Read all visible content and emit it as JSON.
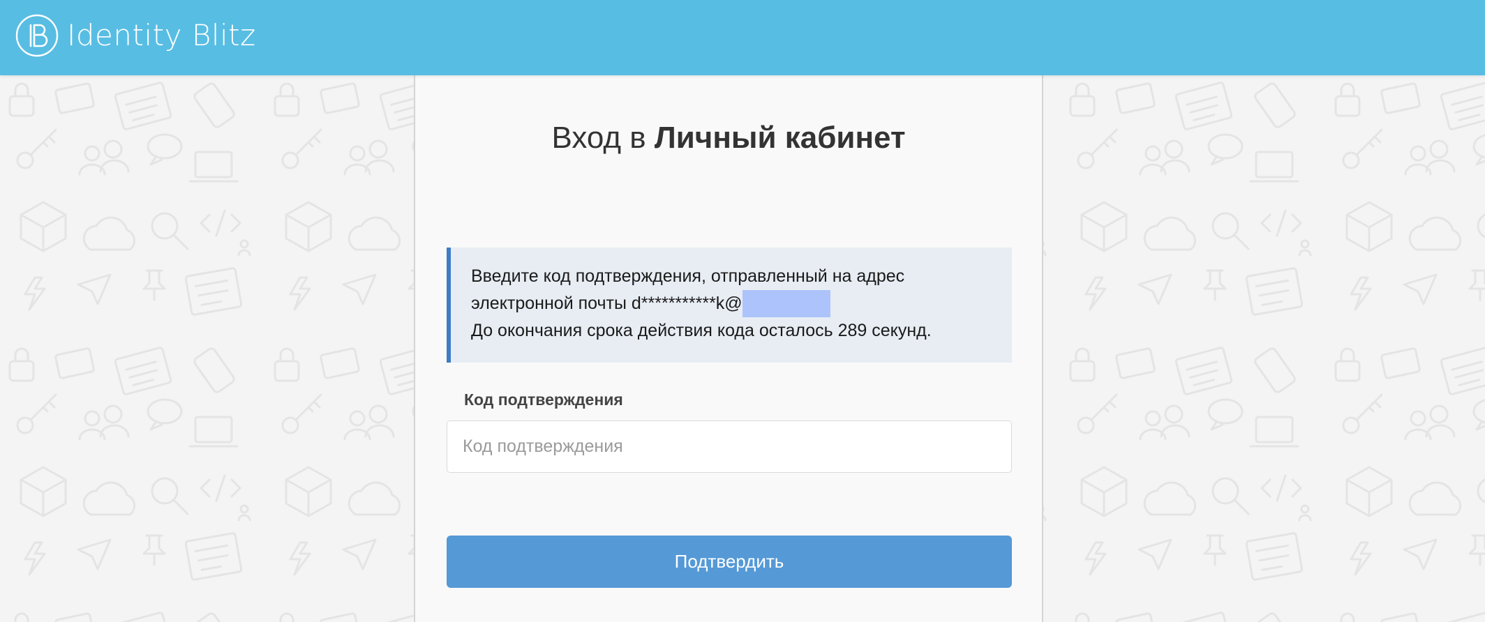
{
  "header": {
    "brand_name": "Identity Blitz",
    "background_color": "#58bde3",
    "logo_icon": "identity-blitz-logo-icon"
  },
  "login": {
    "title_prefix": "Вход в",
    "title_strong": "Личный кабинет",
    "info": {
      "line1": "Введите код подтверждения, отправленный на адрес",
      "line2_prefix": "электронной почты d***********k@",
      "line3": "До окончания срока действия кода осталось 289 секунд.",
      "accent_color": "#3e7cc4",
      "background_color": "#e8edf4"
    },
    "code_field": {
      "label": "Код подтверждения",
      "placeholder": "Код подтверждения",
      "value": ""
    },
    "submit_label": "Подтвердить",
    "submit_color": "#5599d6"
  },
  "background": {
    "pattern_icons": [
      "lock-icon",
      "id-card-icon",
      "document-icon",
      "phone-icon",
      "key-icon",
      "users-icon",
      "sms-bubble-icon",
      "laptop-icon",
      "box-icon",
      "cloud-icon",
      "magnifier-icon",
      "code-icon",
      "lightning-icon",
      "paper-plane-icon",
      "pin-icon"
    ]
  }
}
